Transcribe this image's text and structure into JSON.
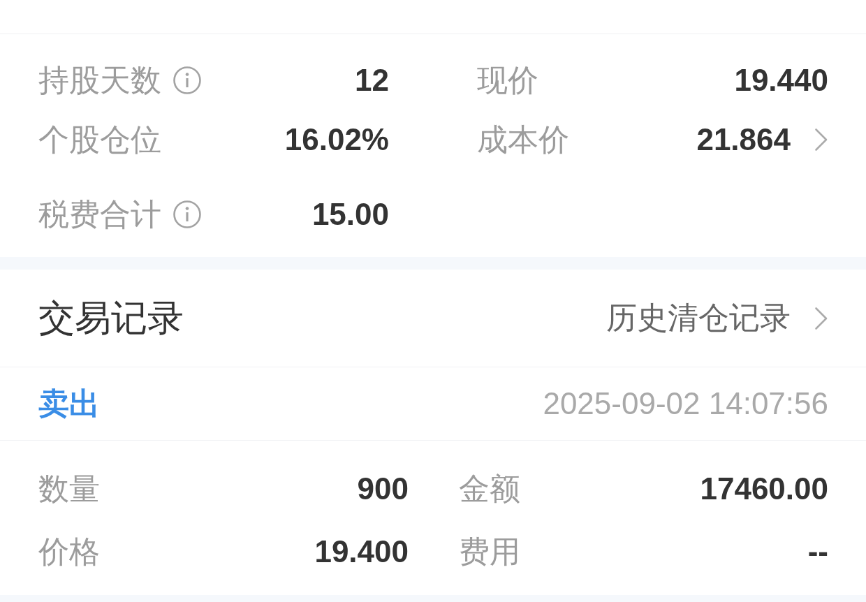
{
  "position_stats": {
    "items": [
      {
        "label": "持股天数",
        "info": true,
        "chevron": false,
        "value": "12"
      },
      {
        "label": "现价",
        "info": false,
        "chevron": false,
        "value": "19.440"
      },
      {
        "label": "个股仓位",
        "info": false,
        "chevron": false,
        "value": "16.02%"
      },
      {
        "label": "成本价",
        "info": false,
        "chevron": true,
        "value": "21.864"
      },
      {
        "label": "税费合计",
        "info": true,
        "chevron": false,
        "value": "15.00"
      }
    ]
  },
  "trade_records": {
    "title": "交易记录",
    "history_link": "历史清仓记录",
    "records": [
      {
        "kind": "sell",
        "side": "卖出",
        "time": "2025-09-02 14:07:56",
        "fields": [
          {
            "label": "数量",
            "value": "900"
          },
          {
            "label": "金额",
            "value": "17460.00"
          },
          {
            "label": "价格",
            "value": "19.400"
          },
          {
            "label": "费用",
            "value": "--"
          }
        ]
      }
    ]
  }
}
